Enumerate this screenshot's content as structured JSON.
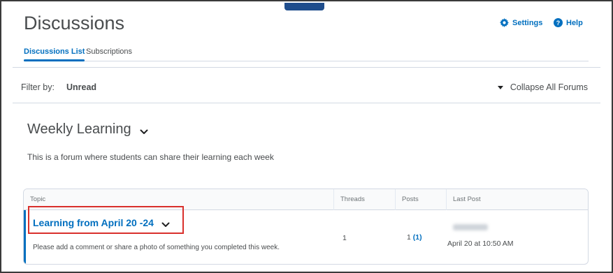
{
  "header": {
    "title": "Discussions",
    "settings_label": "Settings",
    "help_label": "Help"
  },
  "tabs": [
    {
      "label": "Discussions List",
      "active": true
    },
    {
      "label": "Subscriptions",
      "active": false
    }
  ],
  "filter": {
    "label": "Filter by:",
    "value": "Unread",
    "collapse_label": "Collapse All Forums"
  },
  "forum": {
    "title": "Weekly Learning",
    "description": "This is a forum where students can share their learning each week"
  },
  "table": {
    "columns": [
      "Topic",
      "Threads",
      "Posts",
      "Last Post"
    ],
    "rows": [
      {
        "topic": "Learning from April 20 -24",
        "description": "Please add a comment or share a photo of something you completed this week.",
        "threads": "1",
        "posts": "1",
        "posts_unread": "(1)",
        "last_post_date": "April 20 at 10:50 AM"
      }
    ]
  },
  "colors": {
    "link": "#006fbf",
    "highlight_border": "#d9302c",
    "top_tab": "#1f4d8c"
  },
  "icons": {
    "settings": "gear-icon",
    "help": "help-icon",
    "forum_toggle": "chevron-down-icon",
    "collapse": "caret-down-icon"
  }
}
